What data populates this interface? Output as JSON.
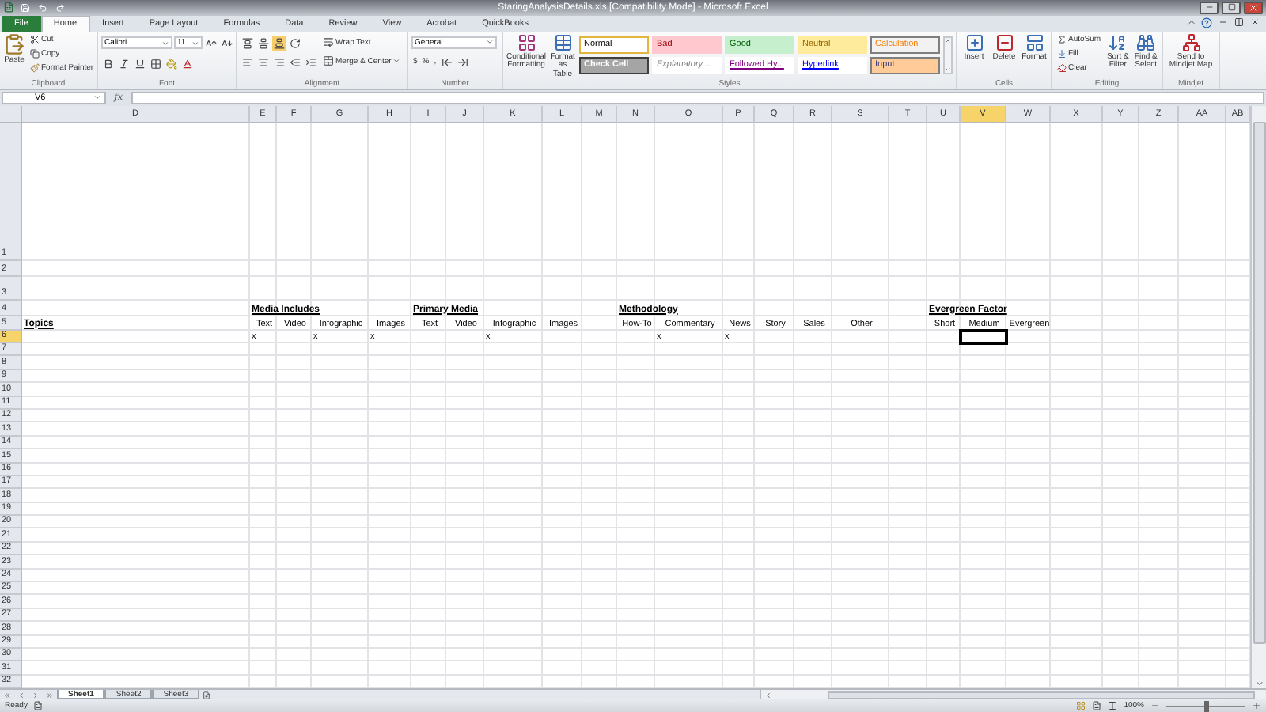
{
  "window": {
    "title": "StaringAnalysisDetails.xls  [Compatibility Mode] - Microsoft Excel"
  },
  "tabs": [
    {
      "label": "File",
      "selected": false,
      "kind": "backstage"
    },
    {
      "label": "Home",
      "selected": true,
      "kind": "tab"
    },
    {
      "label": "Insert",
      "selected": false,
      "kind": "tab"
    },
    {
      "label": "Page Layout",
      "selected": false,
      "kind": "tab"
    },
    {
      "label": "Formulas",
      "selected": false,
      "kind": "tab"
    },
    {
      "label": "Data",
      "selected": false,
      "kind": "tab"
    },
    {
      "label": "Review",
      "selected": false,
      "kind": "tab"
    },
    {
      "label": "View",
      "selected": false,
      "kind": "tab"
    },
    {
      "label": "Acrobat",
      "selected": false,
      "kind": "tab"
    },
    {
      "label": "QuickBooks",
      "selected": false,
      "kind": "tab"
    }
  ],
  "ribbon": {
    "clipboard": {
      "label": "Clipboard",
      "paste": "Paste",
      "cut": "Cut",
      "copy": "Copy",
      "format_painter": "Format Painter"
    },
    "font": {
      "label": "Font",
      "font_name": "Calibri",
      "font_size": "11"
    },
    "alignment": {
      "label": "Alignment",
      "wrap_text": "Wrap Text",
      "merge_center": "Merge & Center"
    },
    "number": {
      "label": "Number",
      "format": "General",
      "currency": "$",
      "percent": "%",
      "comma": ","
    },
    "styles": {
      "label": "Styles",
      "conditional": "Conditional Formatting",
      "format_table": "Format as Table",
      "cells": [
        {
          "label": "Normal",
          "kind": "normal",
          "selected": true
        },
        {
          "label": "Bad",
          "kind": "bad",
          "selected": false
        },
        {
          "label": "Good",
          "kind": "good",
          "selected": false
        },
        {
          "label": "Neutral",
          "kind": "neutral",
          "selected": false
        },
        {
          "label": "Calculation",
          "kind": "calculation",
          "selected": false
        },
        {
          "label": "Check Cell",
          "kind": "check",
          "selected": false
        },
        {
          "label": "Explanatory ...",
          "kind": "explanatory",
          "selected": false
        },
        {
          "label": "Followed Hy...",
          "kind": "followed",
          "selected": false
        },
        {
          "label": "Hyperlink",
          "kind": "hyperlink",
          "selected": false
        },
        {
          "label": "Input",
          "kind": "input",
          "selected": false
        }
      ]
    },
    "cells": {
      "label": "Cells",
      "insert": "Insert",
      "delete": "Delete",
      "format": "Format"
    },
    "editing": {
      "label": "Editing",
      "autosum": "AutoSum",
      "fill": "Fill",
      "clear": "Clear",
      "sort_filter": "Sort & Filter",
      "find_select": "Find & Select"
    },
    "mindjet": {
      "label": "Mindjet",
      "send": "Send to Mindjet Map"
    }
  },
  "formula_bar": {
    "name_box": "V6",
    "fx": "fx"
  },
  "sheet": {
    "columns": [
      {
        "label": "D",
        "selected": false
      },
      {
        "label": "E",
        "selected": false
      },
      {
        "label": "F",
        "selected": false
      },
      {
        "label": "G",
        "selected": false
      },
      {
        "label": "H",
        "selected": false
      },
      {
        "label": "I",
        "selected": false
      },
      {
        "label": "J",
        "selected": false
      },
      {
        "label": "K",
        "selected": false
      },
      {
        "label": "L",
        "selected": false
      },
      {
        "label": "M",
        "selected": false
      },
      {
        "label": "N",
        "selected": false
      },
      {
        "label": "O",
        "selected": false
      },
      {
        "label": "P",
        "selected": false
      },
      {
        "label": "Q",
        "selected": false
      },
      {
        "label": "R",
        "selected": false
      },
      {
        "label": "S",
        "selected": false
      },
      {
        "label": "T",
        "selected": false
      },
      {
        "label": "U",
        "selected": false
      },
      {
        "label": "V",
        "selected": true
      },
      {
        "label": "W",
        "selected": false
      },
      {
        "label": "X",
        "selected": false
      },
      {
        "label": "Y",
        "selected": false
      },
      {
        "label": "Z",
        "selected": false
      },
      {
        "label": "AA",
        "selected": false
      },
      {
        "label": "AB",
        "selected": false
      }
    ],
    "rows": [
      {
        "label": "1",
        "selected": false
      },
      {
        "label": "2",
        "selected": false
      },
      {
        "label": "3",
        "selected": false
      },
      {
        "label": "4",
        "selected": false,
        "cells": [
          {
            "text": "Media Includes",
            "kind": "heading"
          },
          {
            "text": "Primary Media",
            "kind": "heading"
          },
          {
            "text": "Methodology",
            "kind": "heading"
          },
          {
            "text": "Evergreen Factor",
            "kind": "heading"
          }
        ]
      },
      {
        "label": "5",
        "selected": false,
        "cells": [
          {
            "text": "Topics",
            "kind": "heading"
          },
          {
            "text": "Text",
            "kind": "label"
          },
          {
            "text": "Video",
            "kind": "label"
          },
          {
            "text": "Infographic",
            "kind": "label"
          },
          {
            "text": "Images",
            "kind": "label"
          },
          {
            "text": "Text",
            "kind": "label"
          },
          {
            "text": "Video",
            "kind": "label"
          },
          {
            "text": "Infographic",
            "kind": "label"
          },
          {
            "text": "Images",
            "kind": "label"
          },
          {
            "text": "How-To",
            "kind": "label"
          },
          {
            "text": "Commentary",
            "kind": "label"
          },
          {
            "text": "News",
            "kind": "label"
          },
          {
            "text": "Story",
            "kind": "label"
          },
          {
            "text": "Sales",
            "kind": "label"
          },
          {
            "text": "Other",
            "kind": "label"
          },
          {
            "text": "Short",
            "kind": "label"
          },
          {
            "text": "Medium",
            "kind": "label"
          },
          {
            "text": "Evergreen",
            "kind": "label"
          }
        ]
      },
      {
        "label": "6",
        "selected": true,
        "cells": [
          {
            "text": "x",
            "kind": "mark"
          },
          {
            "text": "x",
            "kind": "mark"
          },
          {
            "text": "x",
            "kind": "mark"
          },
          {
            "text": "x",
            "kind": "mark"
          },
          {
            "text": "x",
            "kind": "mark"
          },
          {
            "text": "x",
            "kind": "mark"
          },
          {
            "kind": "active",
            "selected": true
          }
        ]
      },
      {
        "label": "7",
        "selected": false
      },
      {
        "label": "8",
        "selected": false
      },
      {
        "label": "9",
        "selected": false
      },
      {
        "label": "10",
        "selected": false
      },
      {
        "label": "11",
        "selected": false
      },
      {
        "label": "12",
        "selected": false
      },
      {
        "label": "13",
        "selected": false
      },
      {
        "label": "14",
        "selected": false
      },
      {
        "label": "15",
        "selected": false
      },
      {
        "label": "16",
        "selected": false
      },
      {
        "label": "17",
        "selected": false
      },
      {
        "label": "18",
        "selected": false
      },
      {
        "label": "19",
        "selected": false
      },
      {
        "label": "20",
        "selected": false
      },
      {
        "label": "21",
        "selected": false
      },
      {
        "label": "22",
        "selected": false
      },
      {
        "label": "23",
        "selected": false
      },
      {
        "label": "24",
        "selected": false
      },
      {
        "label": "25",
        "selected": false
      },
      {
        "label": "26",
        "selected": false
      },
      {
        "label": "27",
        "selected": false
      },
      {
        "label": "28",
        "selected": false
      },
      {
        "label": "29",
        "selected": false
      },
      {
        "label": "30",
        "selected": false
      },
      {
        "label": "31",
        "selected": false
      },
      {
        "label": "32",
        "selected": false
      }
    ]
  },
  "sheet_tabs": [
    {
      "label": "Sheet1",
      "selected": true
    },
    {
      "label": "Sheet2",
      "selected": false
    },
    {
      "label": "Sheet3",
      "selected": false
    }
  ],
  "status_bar": {
    "status": "Ready",
    "zoom": "100%",
    "zoom_slider": {
      "level": 0.5
    }
  }
}
